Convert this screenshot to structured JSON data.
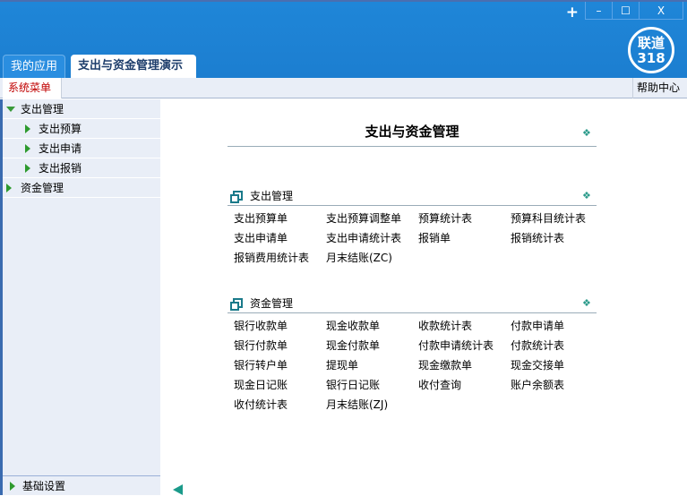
{
  "window": {
    "plus": "+",
    "minimize": "–",
    "maximize": "☐",
    "close": "X"
  },
  "logo": {
    "line1": "联道",
    "line2": "318"
  },
  "tabs": [
    {
      "label": "我的应用"
    },
    {
      "label": "支出与资金管理演示"
    }
  ],
  "menubar": {
    "system_menu": "系统菜单",
    "help": "帮助中心"
  },
  "sidebar": {
    "items": [
      {
        "label": "支出管理",
        "expanded": true
      },
      {
        "label": "支出预算"
      },
      {
        "label": "支出申请"
      },
      {
        "label": "支出报销"
      },
      {
        "label": "资金管理",
        "expanded": false
      }
    ],
    "bottom": "基础设置"
  },
  "main": {
    "title": "支出与资金管理",
    "sections": [
      {
        "title": "支出管理",
        "links": [
          "支出预算单",
          "支出预算调整单",
          "预算统计表",
          "预算科目统计表",
          "支出申请单",
          "支出申请统计表",
          "报销单",
          "报销统计表",
          "报销费用统计表",
          "月末结账(ZC)"
        ]
      },
      {
        "title": "资金管理",
        "links": [
          "银行收款单",
          "现金收款单",
          "收款统计表",
          "付款申请单",
          "银行付款单",
          "现金付款单",
          "付款申请统计表",
          "付款统计表",
          "银行转户单",
          "提现单",
          "现金缴款单",
          "现金交接单",
          "现金日记账",
          "银行日记账",
          "收付查询",
          "账户余额表",
          "收付统计表",
          "月末结账(ZJ)"
        ]
      }
    ]
  }
}
